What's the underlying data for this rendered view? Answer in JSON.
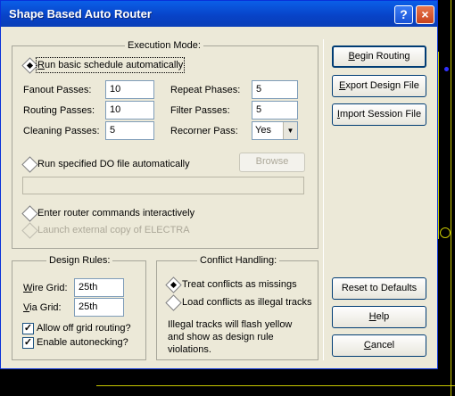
{
  "window": {
    "title": "Shape Based Auto Router",
    "help_glyph": "?",
    "close_glyph": "×"
  },
  "execution": {
    "group_title": "Execution Mode:",
    "run_basic_label": "Run basic schedule automatically",
    "fanout_label": "Fanout Passes:",
    "fanout_value": "10",
    "routing_label": "Routing Passes:",
    "routing_value": "10",
    "cleaning_label": "Cleaning Passes:",
    "cleaning_value": "5",
    "repeat_label": "Repeat Phases:",
    "repeat_value": "5",
    "filter_label": "Filter Passes:",
    "filter_value": "5",
    "recorner_label": "Recorner Pass:",
    "recorner_value": "Yes",
    "do_file_label": "Run specified DO file automatically",
    "browse_label": "Browse",
    "do_file_value": "",
    "interactive_label": "Enter router commands interactively",
    "launch_label": "Launch external copy of ELECTRA"
  },
  "design_rules": {
    "group_title": "Design Rules:",
    "wire_grid_label": "Wire Grid:",
    "wire_grid_value": "25th",
    "via_grid_label": "Via Grid:",
    "via_grid_value": "25th",
    "off_grid_label": "Allow off grid routing?",
    "autonecking_label": "Enable autonecking?"
  },
  "conflict": {
    "group_title": "Conflict Handling:",
    "missings_label": "Treat conflicts as missings",
    "illegal_label": "Load conflicts as illegal tracks",
    "note": "Illegal tracks will flash yellow and show as design rule violations."
  },
  "buttons": {
    "begin_routing": "Begin Routing",
    "export_design": "Export Design File",
    "import_session": "Import Session File",
    "reset_defaults": "Reset to Defaults",
    "help": "Help",
    "cancel": "Cancel"
  },
  "colors": {
    "dialog_face": "#ece9d8",
    "titlebar_blue": "#0842c6",
    "background": "#000000",
    "board_trace": "#c8c800"
  }
}
